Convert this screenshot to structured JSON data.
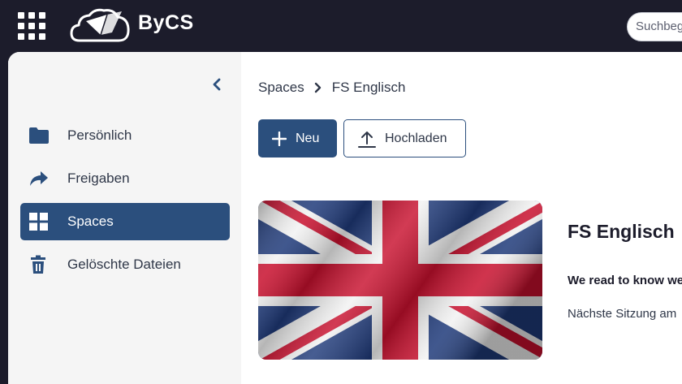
{
  "header": {
    "brand": "ByCS",
    "search_placeholder": "Suchbegriff eingeben"
  },
  "sidebar": {
    "items": [
      {
        "label": "Persönlich",
        "icon": "folder-icon"
      },
      {
        "label": "Freigaben",
        "icon": "share-icon"
      },
      {
        "label": "Spaces",
        "icon": "grid-icon",
        "active": true
      },
      {
        "label": "Gelöschte Dateien",
        "icon": "trash-icon"
      }
    ]
  },
  "breadcrumb": {
    "root": "Spaces",
    "current": "FS Englisch"
  },
  "toolbar": {
    "new_label": "Neu",
    "upload_label": "Hochladen"
  },
  "space": {
    "title": "FS Englisch",
    "description": "We read to know we are not alone.",
    "next_session": "Nächste Sitzung am"
  },
  "colors": {
    "topbar": "#1c1c2b",
    "accent": "#2b4f7d",
    "sidebar_bg": "#f5f5f5",
    "text": "#2f3748"
  }
}
